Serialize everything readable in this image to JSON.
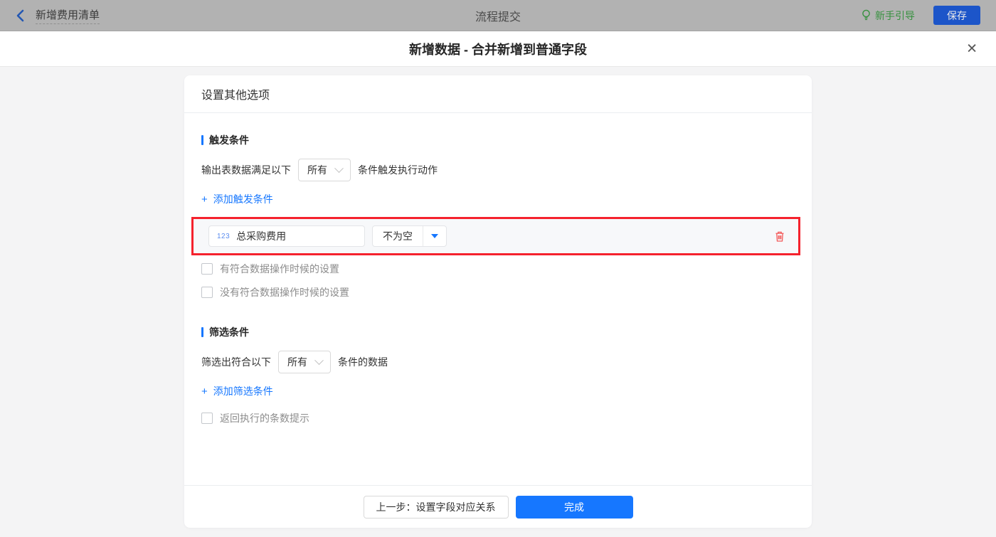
{
  "topbar": {
    "back": "新增费用清单",
    "title": "流程提交",
    "guide": "新手引导",
    "save": "保存"
  },
  "dialog": {
    "title": "新增数据 - 合并新增到普通字段",
    "close_glyph": "✕"
  },
  "panel": {
    "header": "设置其他选项",
    "trigger": {
      "title": "触发条件",
      "row_prefix": "输出表数据满足以下",
      "match_mode": "所有",
      "row_suffix": "条件触发执行动作",
      "plus": "+",
      "add_label": "添加触发条件",
      "condition": {
        "field_type_badge": "123",
        "field_name": "总采购费用",
        "operator": "不为空"
      },
      "checkbox_with_match": "有符合数据操作时候的设置",
      "checkbox_without_match": "没有符合数据操作时候的设置"
    },
    "filter": {
      "title": "筛选条件",
      "row_prefix": "筛选出符合以下",
      "match_mode": "所有",
      "row_suffix": "条件的数据",
      "plus": "+",
      "add_label": "添加筛选条件",
      "checkbox_count_tip": "返回执行的条数提示"
    },
    "footer": {
      "prev": "上一步：设置字段对应关系",
      "done": "完成"
    }
  },
  "colors": {
    "accent_blue": "#1677ff",
    "highlight_red": "#f5222d",
    "guide_green": "#37913f",
    "save_button_blue": "#1c55c9",
    "topbar_gray": "#b2b2b2"
  }
}
